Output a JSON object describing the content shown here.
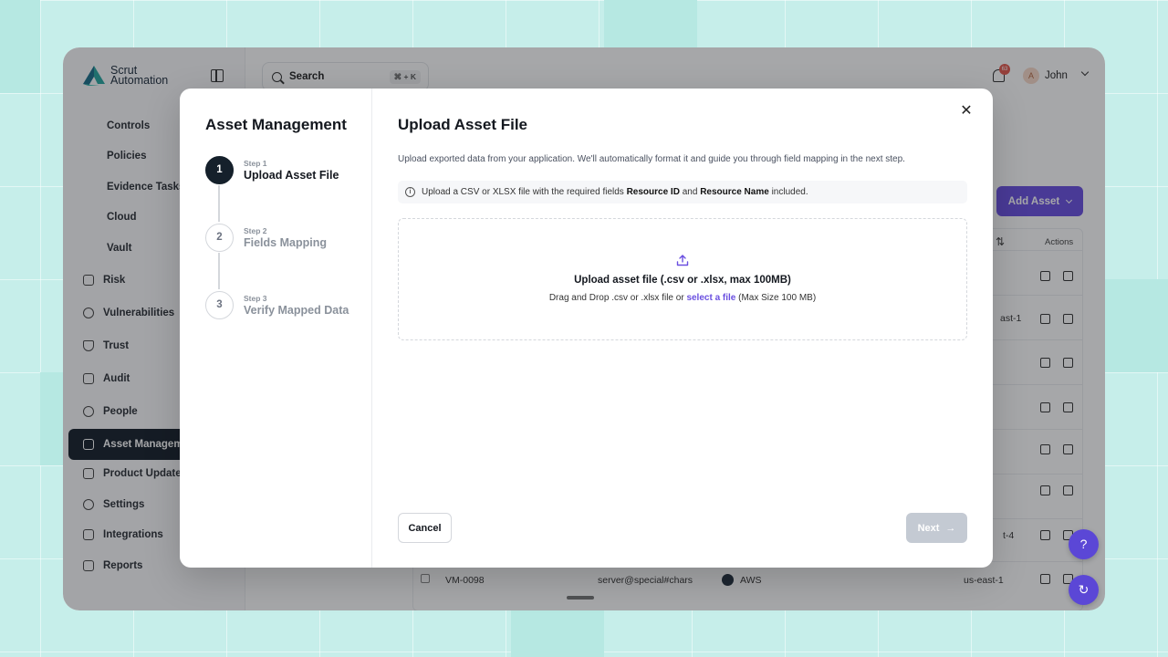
{
  "app": {
    "logo_line1": "Scrut",
    "logo_line2": "Automation",
    "search": {
      "placeholder": "Search",
      "shortcut": "⌘ + K"
    },
    "notifications_count": "63",
    "user": {
      "initial": "A",
      "name": "John"
    }
  },
  "sidebar": {
    "subitems": [
      "Controls",
      "Policies",
      "Evidence Tasks",
      "Cloud",
      "Vault"
    ],
    "items": [
      {
        "label": "Risk",
        "icon": "risk-icon"
      },
      {
        "label": "Vulnerabilities",
        "icon": "vulnerabilities-icon"
      },
      {
        "label": "Trust",
        "icon": "shield-icon"
      },
      {
        "label": "Audit",
        "icon": "audit-icon"
      },
      {
        "label": "People",
        "icon": "people-icon"
      },
      {
        "label": "Asset Manageme",
        "icon": "asset-icon"
      },
      {
        "label": "Product Updates",
        "icon": "megaphone-icon"
      },
      {
        "label": "Settings",
        "icon": "gear-icon"
      },
      {
        "label": "Integrations",
        "icon": "integrations-icon"
      },
      {
        "label": "Reports",
        "icon": "reports-icon"
      }
    ]
  },
  "background_page": {
    "add_asset_label": "Add Asset",
    "table": {
      "actions_header": "Actions",
      "region_fragments": [
        "ast-1",
        "t-4"
      ],
      "last_row": {
        "id": "VM-0098",
        "name": "server@special#chars",
        "provider": "AWS",
        "region": "us-east-1"
      }
    }
  },
  "modal": {
    "sidebar_title": "Asset Management",
    "steps": [
      {
        "number": "1",
        "kicker": "Step 1",
        "label": "Upload Asset File",
        "active": true
      },
      {
        "number": "2",
        "kicker": "Step 2",
        "label": "Fields Mapping",
        "active": false
      },
      {
        "number": "3",
        "kicker": "Step 3",
        "label": "Verify Mapped Data",
        "active": false
      }
    ],
    "title": "Upload Asset File",
    "description": "Upload exported data from your application. We'll automatically format it and guide you through field mapping in the next step.",
    "info": {
      "prefix": "Upload a CSV or XLSX file with the required fields",
      "field1": "Resource ID",
      "and": "and",
      "field2": "Resource Name",
      "suffix": "included."
    },
    "dropzone": {
      "title": "Upload asset file (.csv or .xlsx, max 100MB)",
      "sub_prefix": "Drag and Drop .csv or .xlsx file or",
      "sub_link": "select a file",
      "sub_suffix": "(Max Size 100 MB)"
    },
    "cancel_label": "Cancel",
    "next_label": "Next"
  },
  "colors": {
    "accent": "#6a4fe0",
    "dark": "#15202b",
    "background": "#c6eeea"
  }
}
